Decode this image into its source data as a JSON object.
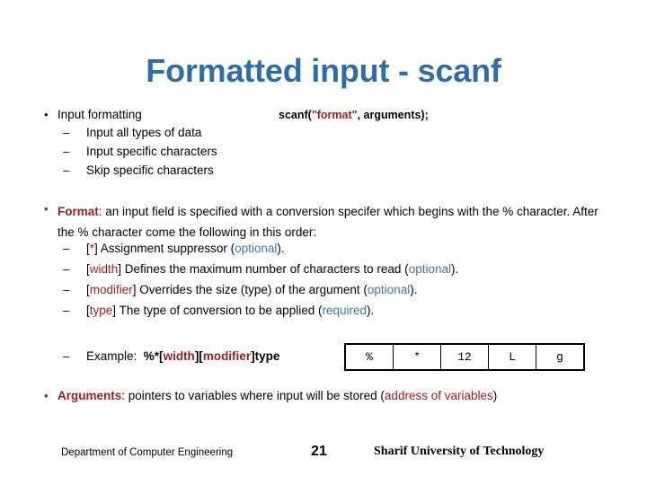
{
  "slide": {
    "title": "Formatted input - scanf",
    "title_color": "#2E6DA8",
    "accent_red": "#9E1B1B",
    "accent_blue": "#3C78A8"
  },
  "code_snippet": {
    "prefix": "scanf(",
    "format_literal": "\"format\"",
    "suffix": ", arguments);"
  },
  "bullet1": {
    "marker": "•",
    "text": "Input formatting",
    "sub_items": [
      {
        "marker": "–",
        "text": "Input all types of data"
      },
      {
        "marker": "–",
        "text": "Input specific characters"
      },
      {
        "marker": "–",
        "text": "Skip specific characters"
      }
    ]
  },
  "bullet2": {
    "marker": "•",
    "label": "Format",
    "body": ": an input field is specified with a conversion specifer which begins with the % character. After the % character come the following in this order:",
    "sub_items": [
      {
        "marker": "–",
        "open_bracket": "[",
        "token": "*",
        "close_bracket": "]",
        "description": " Assignment suppressor (",
        "qualifier": "optional",
        "tail": ")."
      },
      {
        "marker": "–",
        "open_bracket": "[",
        "token": "width",
        "close_bracket": "]",
        "description": " Defines the maximum number of characters to read (",
        "qualifier": "optional",
        "tail": ")."
      },
      {
        "marker": "–",
        "open_bracket": "[",
        "token": "modifier",
        "close_bracket": "]",
        "description": " Overrides the size (type) of the argument (",
        "qualifier": "optional",
        "tail": ")."
      },
      {
        "marker": "–",
        "open_bracket": "[",
        "token": "type",
        "close_bracket": "]",
        "description": " The type of conversion to be applied (",
        "qualifier": "required",
        "tail": ")."
      }
    ],
    "example": {
      "marker": "–",
      "label": "Example:",
      "percent_star": "%*[",
      "width_token": "width",
      "mid1": "][",
      "modifier_token": "modifier",
      "mid2": "]",
      "type_token": "type"
    }
  },
  "format_table": {
    "cells": [
      "%",
      "*",
      "12",
      "L",
      "g"
    ]
  },
  "bullet3": {
    "marker": "•",
    "label": "Arguments",
    "body": ": pointers to variables where input will be stored (",
    "highlight": "address of variables",
    "tail": ")"
  },
  "footer": {
    "department": "Department of Computer Engineering",
    "page_number": "21",
    "university": "Sharif University of Technology"
  }
}
